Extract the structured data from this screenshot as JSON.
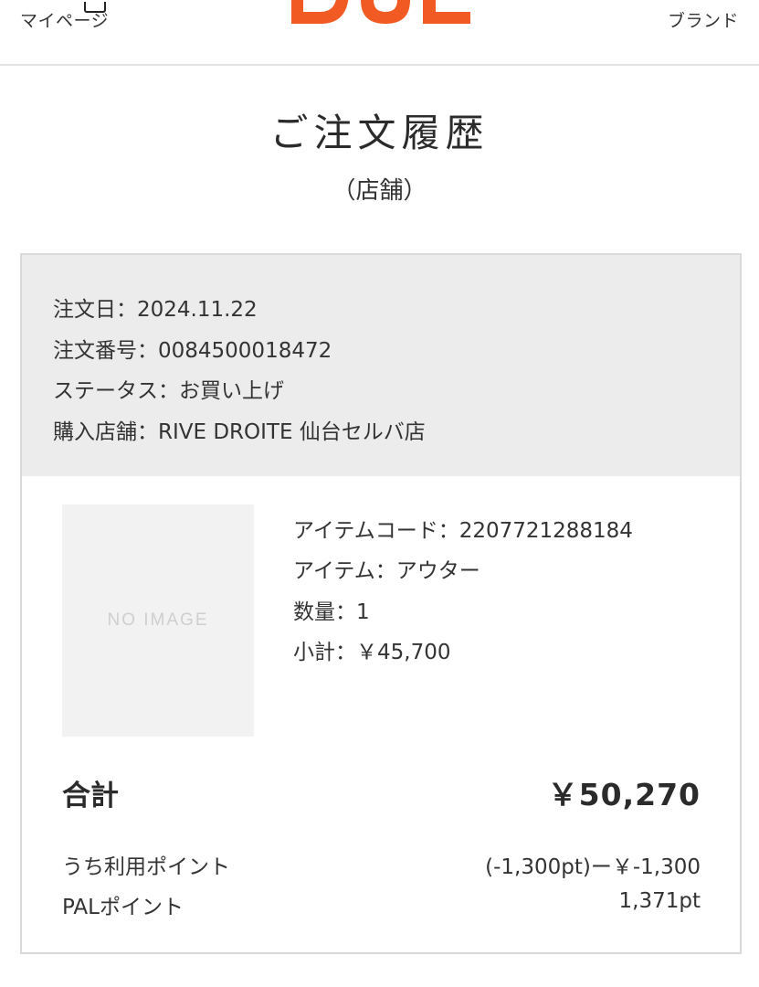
{
  "header": {
    "left_label": "マイページ",
    "right_label": "ブランド",
    "brand_color": "#f15a22",
    "logo_name": "PAL logo (partially visible)"
  },
  "page": {
    "title": "ご注文履歴",
    "subtitle": "（店舗）"
  },
  "order": {
    "date": "注文日：2024.11.22",
    "number": "注文番号：0084500018472",
    "status": "ステータス：お買い上げ",
    "store": "購入店舗：RIVE DROITE 仙台セルバ店"
  },
  "item": {
    "image_placeholder": "NO IMAGE",
    "code": "アイテムコード：2207721288184",
    "name": "アイテム：アウター",
    "quantity": "数量：1",
    "subtotal": "小計：￥45,700"
  },
  "totals": {
    "total_label": "合計",
    "total_value": "￥50,270",
    "points_used_label": "うち利用ポイント",
    "points_used_value": "(-1,300pt)ー￥-1,300",
    "pal_points_label": "PALポイント",
    "pal_points_value": "1,371pt"
  }
}
